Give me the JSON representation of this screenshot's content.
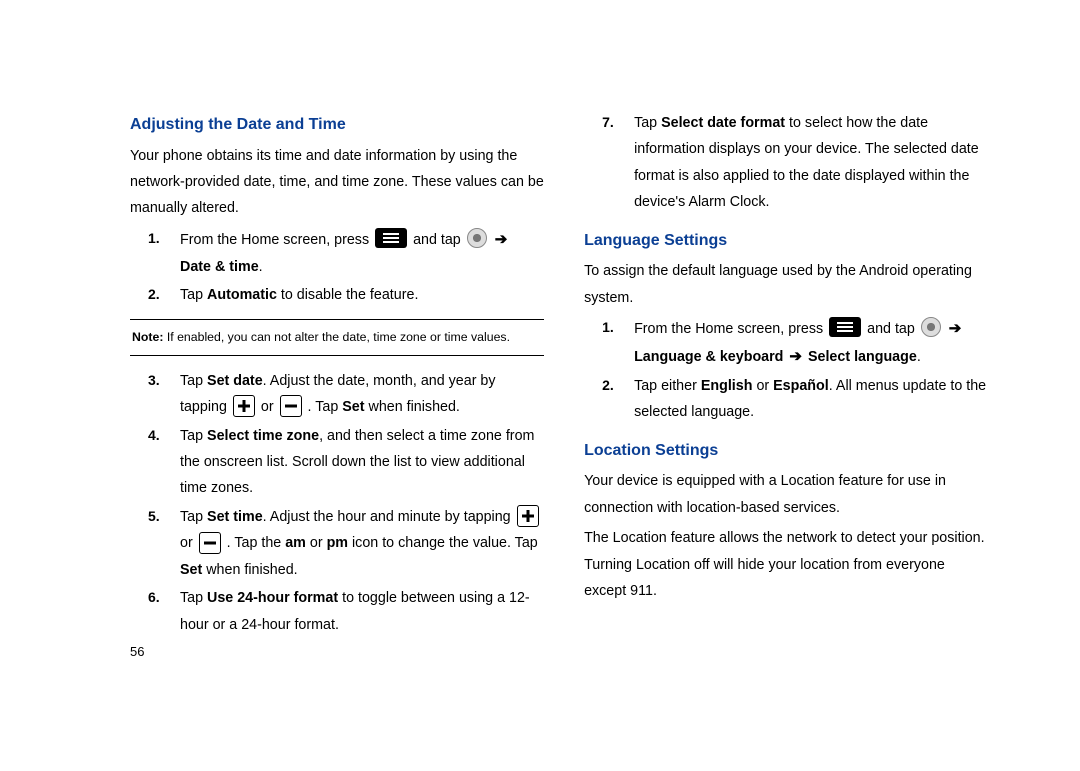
{
  "page_number": "56",
  "left": {
    "heading": "Adjusting the Date and Time",
    "intro": "Your phone obtains its time and date information by using the network-provided date, time, and time zone. These values can be manually altered.",
    "step1_a": "From the Home screen, press ",
    "step1_b": " and tap ",
    "step1_c": "Date & time",
    "step1_d": ".",
    "step2_a": "Tap ",
    "step2_b": "Automatic",
    "step2_c": " to disable the feature.",
    "note_label": "Note:",
    "note_text": " If enabled, you can not alter the date, time zone or time values.",
    "step3_a": "Tap ",
    "step3_b": "Set date",
    "step3_c": ". Adjust the date, month, and year by tapping ",
    "step3_d": " or ",
    "step3_e": ". Tap ",
    "step3_f": "Set",
    "step3_g": " when finished.",
    "step4_a": "Tap ",
    "step4_b": "Select time zone",
    "step4_c": ", and then select a time zone from the onscreen list. Scroll down the list to view additional time zones.",
    "step5_a": "Tap ",
    "step5_b": "Set time",
    "step5_c": ". Adjust the hour and minute by tapping ",
    "step5_d": " or ",
    "step5_e": ". Tap the ",
    "step5_f": "am",
    "step5_g": " or ",
    "step5_h": "pm",
    "step5_i": " icon to change the value. Tap ",
    "step5_j": "Set",
    "step5_k": " when finished.",
    "step6_a": "Tap ",
    "step6_b": "Use 24-hour format",
    "step6_c": " to toggle between using a 12-hour or a 24-hour format."
  },
  "right": {
    "step7_a": "Tap ",
    "step7_b": "Select date format",
    "step7_c": " to select how the date information displays on your device. The selected date format is also applied to the date displayed within the device's Alarm Clock.",
    "lang_heading": "Language Settings",
    "lang_intro": "To assign the default language used by the Android operating system.",
    "lstep1_a": "From the Home screen, press ",
    "lstep1_b": " and tap ",
    "lstep1_c": "Language & keyboard",
    "lstep1_d": "Select language",
    "lstep1_e": ".",
    "lstep2_a": "Tap either ",
    "lstep2_b": "English",
    "lstep2_c": " or ",
    "lstep2_d": "Español",
    "lstep2_e": ". All menus update to the selected language.",
    "loc_heading": "Location Settings",
    "loc_p1": "Your device is equipped with a Location feature for use in connection with location-based services.",
    "loc_p2": "The Location feature allows the network to detect your position. Turning Location off will hide your location from everyone except 911."
  },
  "arrow": "➔"
}
